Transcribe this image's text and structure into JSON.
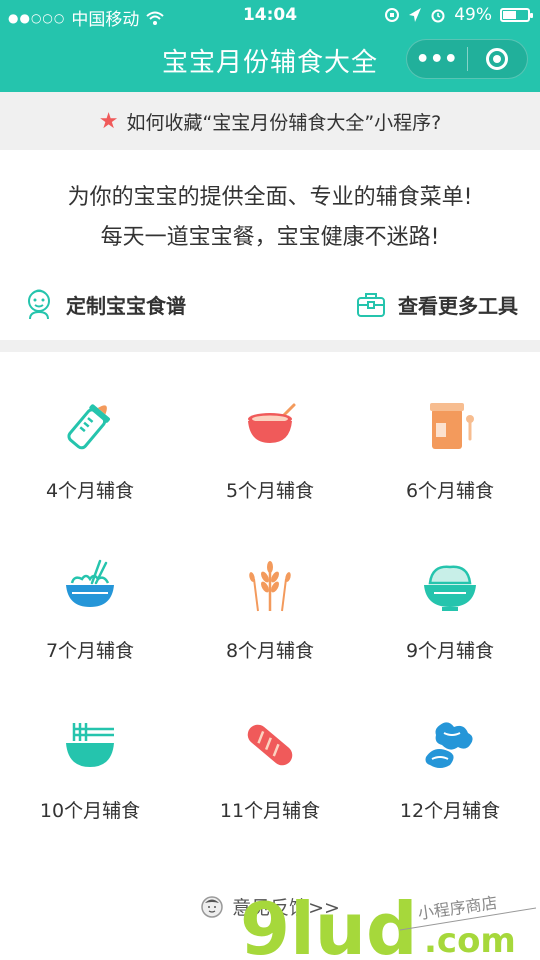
{
  "status_bar": {
    "signal": "●●○○○",
    "carrier": "中国移动",
    "time": "14:04",
    "battery": "49%",
    "battery_level": 0.49
  },
  "title_bar": {
    "title": "宝宝月份辅食大全",
    "more_label": "•••"
  },
  "collect_banner": {
    "text": "如何收藏“宝宝月份辅食大全”小程序?"
  },
  "intro": {
    "line1": "为你的宝宝的提供全面、专业的辅食菜单!",
    "line2": "每天一道宝宝餐，宝宝健康不迷路!"
  },
  "tools": {
    "custom_recipe": "定制宝宝食谱",
    "more_tools": "查看更多工具"
  },
  "months": [
    {
      "label": "4个月辅食",
      "icon": "baby-bottle-icon"
    },
    {
      "label": "5个月辅食",
      "icon": "bowl-spoon-icon"
    },
    {
      "label": "6个月辅食",
      "icon": "milk-powder-can-icon"
    },
    {
      "label": "7个月辅食",
      "icon": "noodle-bowl-icon"
    },
    {
      "label": "8个月辅食",
      "icon": "wheat-icon"
    },
    {
      "label": "9个月辅食",
      "icon": "rice-bowl-icon"
    },
    {
      "label": "10个月辅食",
      "icon": "noodles-icon"
    },
    {
      "label": "11个月辅食",
      "icon": "bread-icon"
    },
    {
      "label": "12个月辅食",
      "icon": "vegetables-icon"
    }
  ],
  "feedback": {
    "label": "意见反馈>>"
  },
  "watermark": {
    "brand": "9lud",
    "domain": ".com",
    "tagline": "小程序商店"
  },
  "colors": {
    "brand": "#25c4ad",
    "accent_red": "#f05a5a",
    "accent_orange": "#f39a5c",
    "watermark_green": "#a6d83b"
  }
}
